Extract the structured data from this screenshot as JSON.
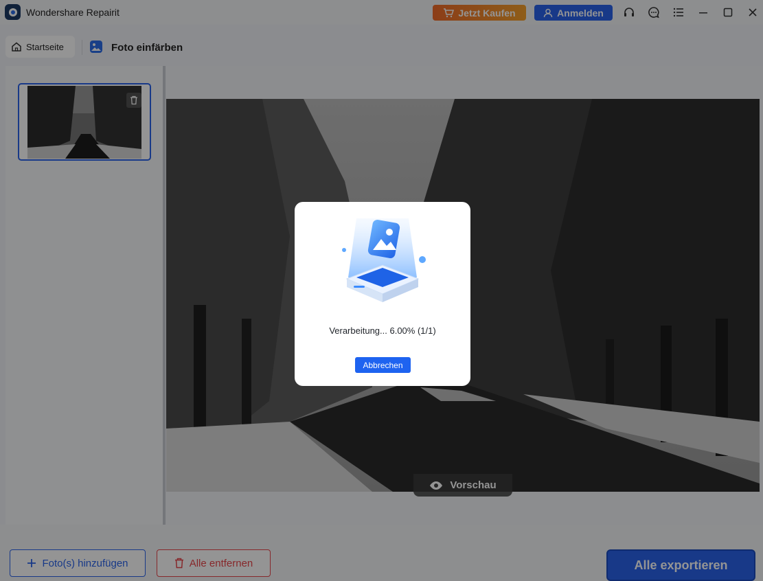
{
  "window": {
    "title": "Wondershare Repairit"
  },
  "titlebar": {
    "buy_label": "Jetzt Kaufen",
    "login_label": "Anmelden",
    "icons": [
      "headset-icon",
      "chat-icon",
      "menu-icon",
      "minimize-icon",
      "maximize-icon",
      "close-icon"
    ]
  },
  "nav": {
    "home_label": "Startseite",
    "page_title": "Foto einfärben"
  },
  "preview": {
    "label": "Vorschau"
  },
  "bottom": {
    "add_label": "Foto(s) hinzufügen",
    "remove_label": "Alle entfernen",
    "export_label": "Alle exportieren"
  },
  "dialog": {
    "status_text": "Verarbeitung... 6.00% (1/1)",
    "progress_percent": 6.0,
    "cancel_label": "Abbrechen"
  },
  "colors": {
    "accent": "#2a63ea",
    "buy_start": "#f16a2a",
    "buy_end": "#f4a12c",
    "danger": "#e8454a"
  }
}
